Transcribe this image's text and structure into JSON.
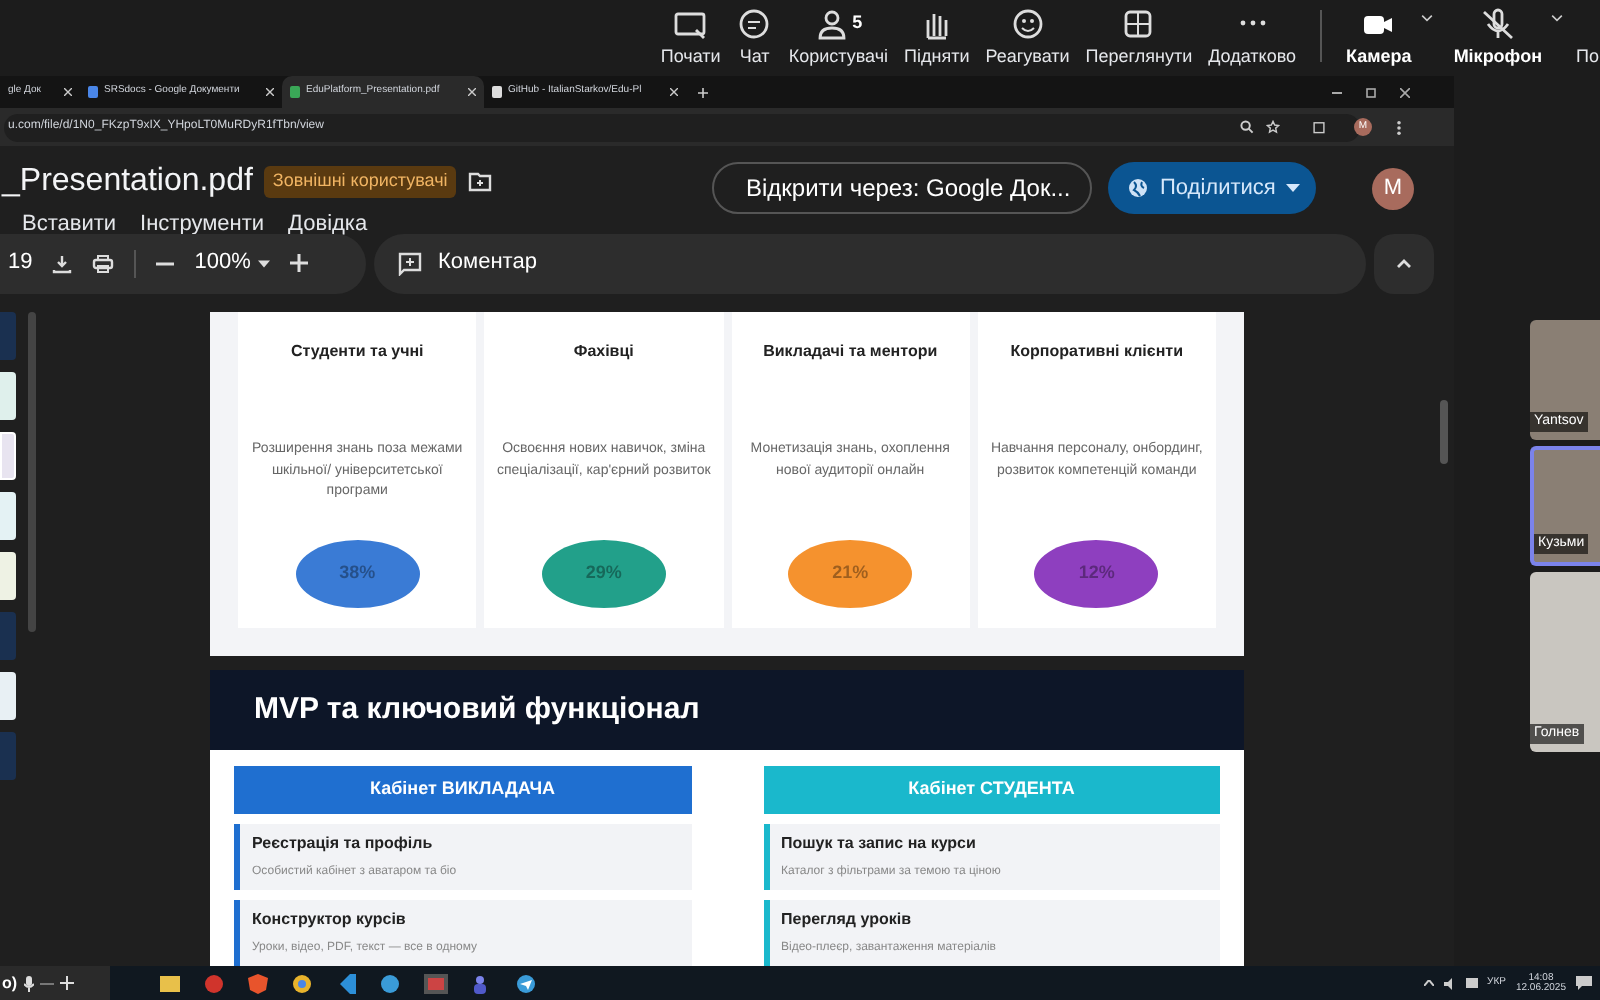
{
  "meeting_toolbar": {
    "items": [
      {
        "kind": "share",
        "label": "Почати"
      },
      {
        "kind": "chat",
        "label": "Чат"
      },
      {
        "kind": "people",
        "label": "Користувачі",
        "count": "5"
      },
      {
        "kind": "hand",
        "label": "Підняти"
      },
      {
        "kind": "react",
        "label": "Реагувати"
      },
      {
        "kind": "view",
        "label": "Переглянути"
      },
      {
        "kind": "more",
        "label": "Додатково"
      },
      {
        "kind": "camera",
        "label": "Камера"
      },
      {
        "kind": "mic",
        "label": "Мікрофон"
      },
      {
        "kind": "cut",
        "label": "По"
      }
    ]
  },
  "browser": {
    "tabs": [
      {
        "title": "gle Док",
        "selected": false
      },
      {
        "title": "SRSdocs - Google Документи",
        "selected": false
      },
      {
        "title": "EduPlatform_Presentation.pdf",
        "selected": true
      },
      {
        "title": "GitHub - ItalianStarkov/Edu-Pl",
        "selected": false
      }
    ],
    "address": "u.com/file/d/1N0_FKzpT9xIX_YHpoLT0MuRDyR1fTbn/view",
    "profile": "M"
  },
  "drive": {
    "file_title": "_Presentation.pdf",
    "badge": "Зовнішні користувачі",
    "menu": [
      "Вставити",
      "Інструменти",
      "Довідка"
    ],
    "open_with": "Відкрити через: Google Док...",
    "share": "Поділитися",
    "avatar": "M"
  },
  "pdf_toolbar": {
    "page": "19",
    "zoom": "100%",
    "comment": "Коментар"
  },
  "slide_1": {
    "cards": [
      {
        "title": "Студенти та учні",
        "description": "Розширення знань поза межами шкільної/ університетської програми",
        "percent": "38%",
        "color": "#3a7bd5"
      },
      {
        "title": "Фахівці",
        "description": "Освоєння нових навичок, зміна спеціалізації, кар'єрний розвиток",
        "percent": "29%",
        "color": "#22a08a"
      },
      {
        "title": "Викладачі та ментори",
        "description": "Монетизація знань, охоплення нової аудиторії онлайн",
        "percent": "21%",
        "color": "#f5922e"
      },
      {
        "title": "Корпоративні клієнти",
        "description": "Навчання персоналу, онбординг, розвиток компетенцій команди",
        "percent": "12%",
        "color": "#8e3fbf"
      }
    ]
  },
  "slide_2": {
    "title": "MVP та ключовий функціонал",
    "columns": [
      {
        "heading": "Кабінет ВИКЛАДАЧА",
        "color": "#1f6fd0",
        "features": [
          {
            "title": "Реєстрація та профіль",
            "description": "Особистий кабінет з аватаром та біо"
          },
          {
            "title": "Конструктор курсів",
            "description": "Уроки, відео, PDF, текст — все в одному"
          }
        ]
      },
      {
        "heading": "Кабінет СТУДЕНТА",
        "color": "#1ab8cc",
        "features": [
          {
            "title": "Пошук та запис на курси",
            "description": "Каталог з фільтрами за темою та ціною"
          },
          {
            "title": "Перегляд уроків",
            "description": "Відео-плеєр, завантаження матеріалів"
          }
        ]
      }
    ]
  },
  "participants": [
    {
      "name": "Yantsov",
      "active": false
    },
    {
      "name": "Кузьми",
      "active": true
    },
    {
      "name": "Голнев",
      "active": false
    }
  ],
  "floating_control": {
    "label": "о)"
  },
  "taskbar": {
    "language": "УКР",
    "time": "14:08",
    "date": "12.06.2025"
  }
}
